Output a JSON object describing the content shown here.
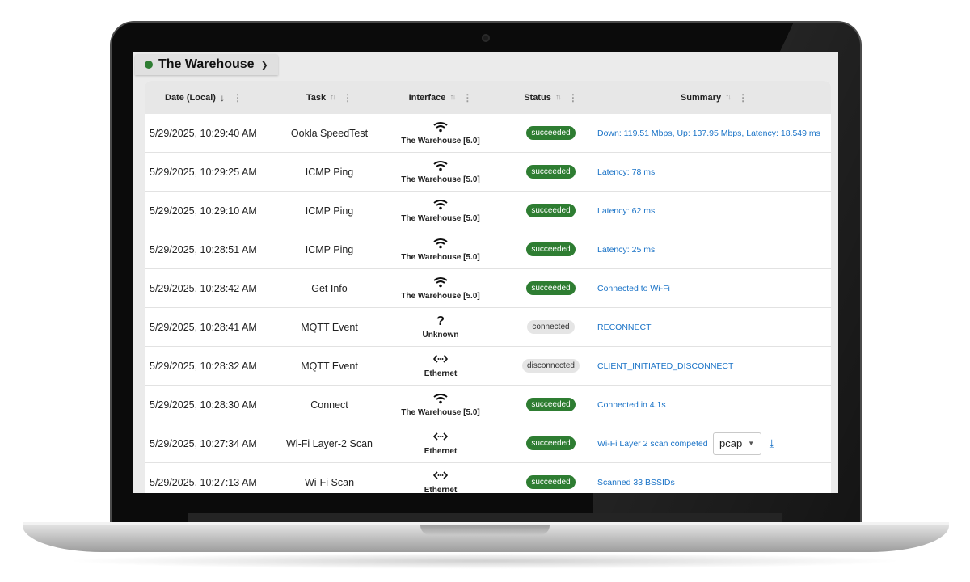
{
  "site": {
    "name": "The Warehouse",
    "status_color": "#2e7d32"
  },
  "columns": {
    "date": "Date (Local)",
    "task": "Task",
    "interface": "Interface",
    "status": "Status",
    "summary": "Summary"
  },
  "rows": [
    {
      "date": "5/29/2025, 10:29:40 AM",
      "task": "Ookla SpeedTest",
      "iface_icon": "wifi-icon",
      "iface": "The Warehouse [5.0]",
      "status": "succeeded",
      "summary": "Down: 119.51 Mbps, Up: 137.95 Mbps, Latency: 18.549 ms"
    },
    {
      "date": "5/29/2025, 10:29:25 AM",
      "task": "ICMP Ping",
      "iface_icon": "wifi-icon",
      "iface": "The Warehouse [5.0]",
      "status": "succeeded",
      "summary": "Latency: 78 ms"
    },
    {
      "date": "5/29/2025, 10:29:10 AM",
      "task": "ICMP Ping",
      "iface_icon": "wifi-icon",
      "iface": "The Warehouse [5.0]",
      "status": "succeeded",
      "summary": "Latency: 62 ms"
    },
    {
      "date": "5/29/2025, 10:28:51 AM",
      "task": "ICMP Ping",
      "iface_icon": "wifi-icon",
      "iface": "The Warehouse [5.0]",
      "status": "succeeded",
      "summary": "Latency: 25 ms"
    },
    {
      "date": "5/29/2025, 10:28:42 AM",
      "task": "Get Info",
      "iface_icon": "wifi-icon",
      "iface": "The Warehouse [5.0]",
      "status": "succeeded",
      "summary": "Connected to Wi-Fi"
    },
    {
      "date": "5/29/2025, 10:28:41 AM",
      "task": "MQTT Event",
      "iface_icon": "question-icon",
      "iface": "Unknown",
      "status": "connected",
      "summary": "RECONNECT"
    },
    {
      "date": "5/29/2025, 10:28:32 AM",
      "task": "MQTT Event",
      "iface_icon": "ethernet-icon",
      "iface": "Ethernet",
      "status": "disconnected",
      "summary": "CLIENT_INITIATED_DISCONNECT"
    },
    {
      "date": "5/29/2025, 10:28:30 AM",
      "task": "Connect",
      "iface_icon": "wifi-icon",
      "iface": "The Warehouse [5.0]",
      "status": "succeeded",
      "summary": "Connected in 4.1s"
    },
    {
      "date": "5/29/2025, 10:27:34 AM",
      "task": "Wi-Fi Layer-2 Scan",
      "iface_icon": "ethernet-icon",
      "iface": "Ethernet",
      "status": "succeeded",
      "summary": "Wi-Fi Layer 2 scan competed",
      "format_select": "pcap",
      "download_icon": "download-icon"
    },
    {
      "date": "5/29/2025, 10:27:13 AM",
      "task": "Wi-Fi Scan",
      "iface_icon": "ethernet-icon",
      "iface": "Ethernet",
      "status": "succeeded",
      "summary": "Scanned 33 BSSIDs"
    }
  ],
  "colors": {
    "success": "#2e7d32",
    "link": "#1a73c7",
    "neutral_badge": "#e5e5e5"
  }
}
